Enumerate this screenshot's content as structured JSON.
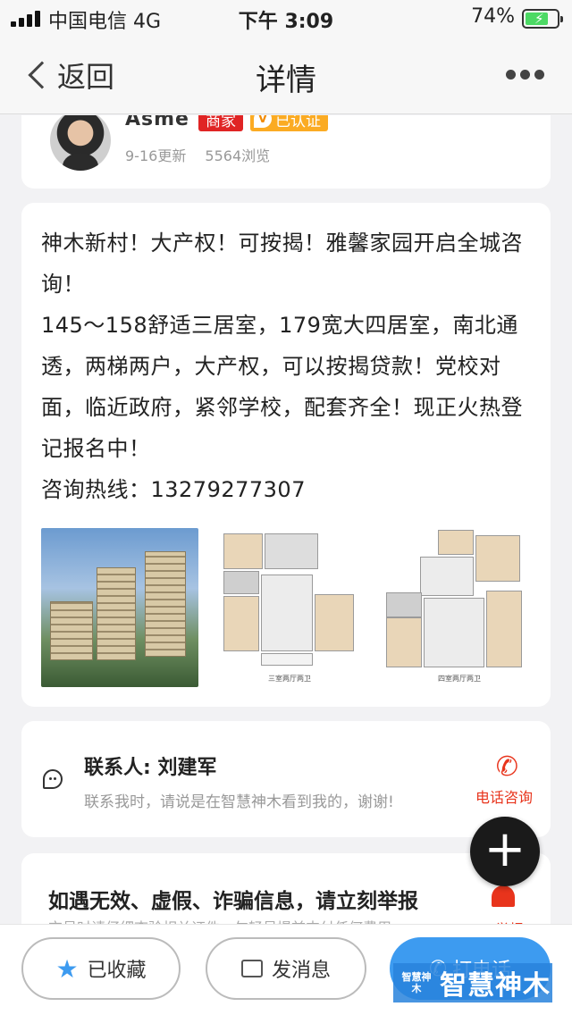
{
  "status_bar": {
    "carrier": "中国电信 4G",
    "time": "下午 3:09",
    "battery": "74%"
  },
  "nav": {
    "back_label": "返回",
    "title": "详情"
  },
  "profile": {
    "username": "Asme",
    "merchant_badge": "商家",
    "verified_badge": "已认证",
    "updated": "9-16更新",
    "views": "5564浏览"
  },
  "post": {
    "lines": [
      "神木新村！大产权！可按揭！雅馨家园开启全城咨询！",
      "145～158舒适三居室，179宽大四居室，南北通透，两梯两户，大产权，可以按揭贷款！党校对面，临近政府，紧邻学校，配套齐全！现正火热登记报名中！",
      "咨询热线：13279277307"
    ],
    "plan_captions": [
      "三室两厅两卫",
      "四室两厅两卫"
    ]
  },
  "contact": {
    "name": "联系人: 刘建军",
    "note": "联系我时，请说是在智慧神木看到我的，谢谢!",
    "phone_label": "电话咨询"
  },
  "report": {
    "title": "如遇无效、虚假、诈骗信息，请立刻举报",
    "subtitle": "交易时请仔细查验相关证件，勿轻易提前支付任何费用",
    "label": "举报"
  },
  "bottom": {
    "favorite": "已收藏",
    "message": "发消息",
    "call": "打电话",
    "watermark_logo": "智慧神木",
    "watermark_text": "智慧神木"
  },
  "colors": {
    "accent_blue": "#3d9bf0",
    "alert_red": "#e8341c",
    "merchant_red": "#e02424",
    "verified_orange": "#fbab23"
  }
}
